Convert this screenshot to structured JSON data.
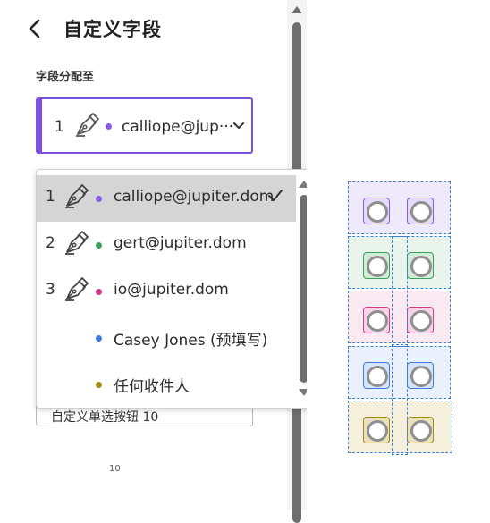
{
  "header": {
    "title": "自定义字段"
  },
  "assign": {
    "label": "字段分配至",
    "selected_index": "1",
    "selected_email": "calliope@jup···",
    "color": "#8a5ce6"
  },
  "dropdown": {
    "options": [
      {
        "index": "1",
        "text": "calliope@jupiter.dom",
        "color": "#8a5ce6",
        "selected": true
      },
      {
        "index": "2",
        "text": "gert@jupiter.dom",
        "color": "#3aa05a"
      },
      {
        "index": "3",
        "text": "io@jupiter.dom",
        "color": "#d23a8c"
      },
      {
        "index": "",
        "text": "Casey Jones (预填写)",
        "color": "#3b7ee0"
      },
      {
        "index": "",
        "text": "任何收件人",
        "color": "#a08a14"
      }
    ]
  },
  "hidden_field": {
    "text": "自定义单选按钮 10"
  },
  "fragment": "10",
  "canvas": {
    "rows": [
      {
        "fill": "#efeafb",
        "btn": "#e4dafa",
        "border": "#8a5ce6"
      },
      {
        "fill": "#e9f5ec",
        "btn": "#d3ebd9",
        "border": "#3aa05a"
      },
      {
        "fill": "#fbe9f2",
        "btn": "#f7d4e7",
        "border": "#d23a8c"
      },
      {
        "fill": "#eaf1fc",
        "btn": "#d6e4fa",
        "border": "#3b7ee0"
      },
      {
        "fill": "#f4f0dc",
        "btn": "#eae2bf",
        "border": "#a08a14"
      }
    ]
  }
}
